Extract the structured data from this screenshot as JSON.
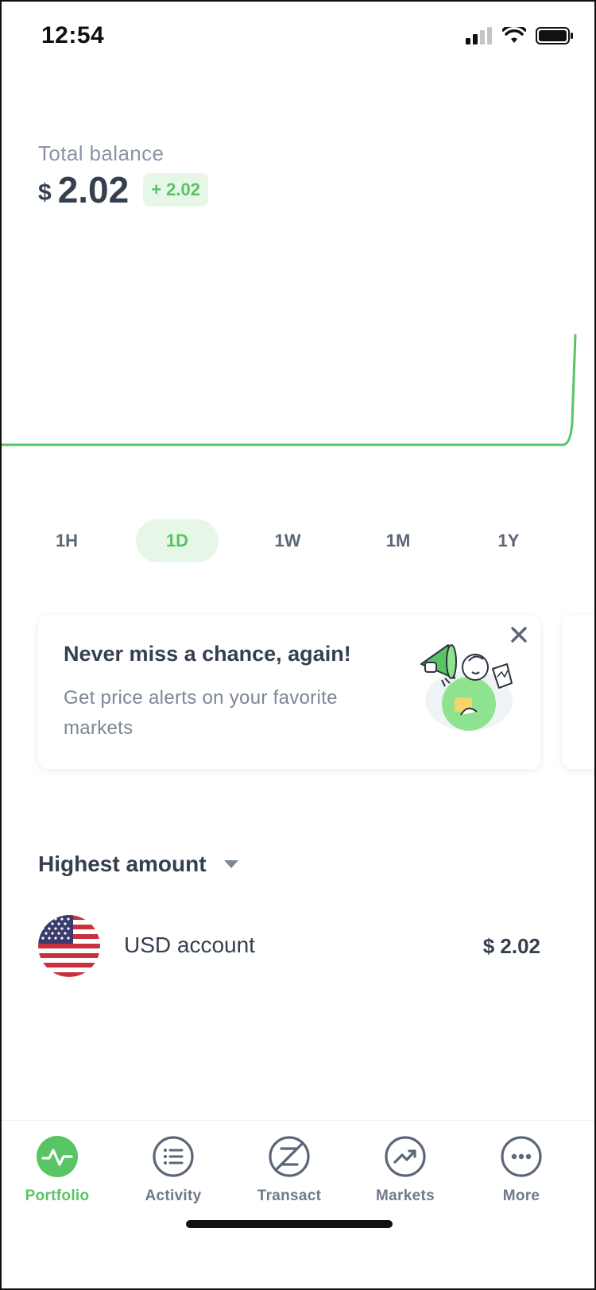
{
  "status_bar": {
    "time": "12:54",
    "icons": [
      "cellular-signal-icon",
      "wifi-icon",
      "battery-icon"
    ]
  },
  "balance": {
    "label": "Total balance",
    "currency": "$",
    "amount": "2.02",
    "change": "+ 2.02"
  },
  "chart": {
    "type": "line",
    "color": "#58c464",
    "trend": "flat then sharp rise at the end"
  },
  "time_ranges": {
    "options": [
      "1H",
      "1D",
      "1W",
      "1M",
      "1Y"
    ],
    "selected": "1D"
  },
  "promo": {
    "title": "Never miss a chance, again!",
    "text": "Get price alerts on your favorite markets",
    "close_icon": "close-icon",
    "illustration": "megaphone-person-illustration"
  },
  "accounts": {
    "sort_label": "Highest amount",
    "items": [
      {
        "name": "USD account",
        "amount": "$ 2.02",
        "icon": "us-flag-icon"
      }
    ]
  },
  "nav": {
    "items": [
      {
        "label": "Portfolio",
        "icon": "portfolio-pulse-icon",
        "active": true
      },
      {
        "label": "Activity",
        "icon": "activity-list-icon",
        "active": false
      },
      {
        "label": "Transact",
        "icon": "transact-icon",
        "active": false
      },
      {
        "label": "Markets",
        "icon": "markets-trend-icon",
        "active": false
      },
      {
        "label": "More",
        "icon": "more-dots-icon",
        "active": false
      }
    ]
  },
  "colors": {
    "accent": "#58c464",
    "accent_light": "#e6f6e7",
    "text_primary": "#34404f",
    "text_secondary": "#8a94a6"
  }
}
